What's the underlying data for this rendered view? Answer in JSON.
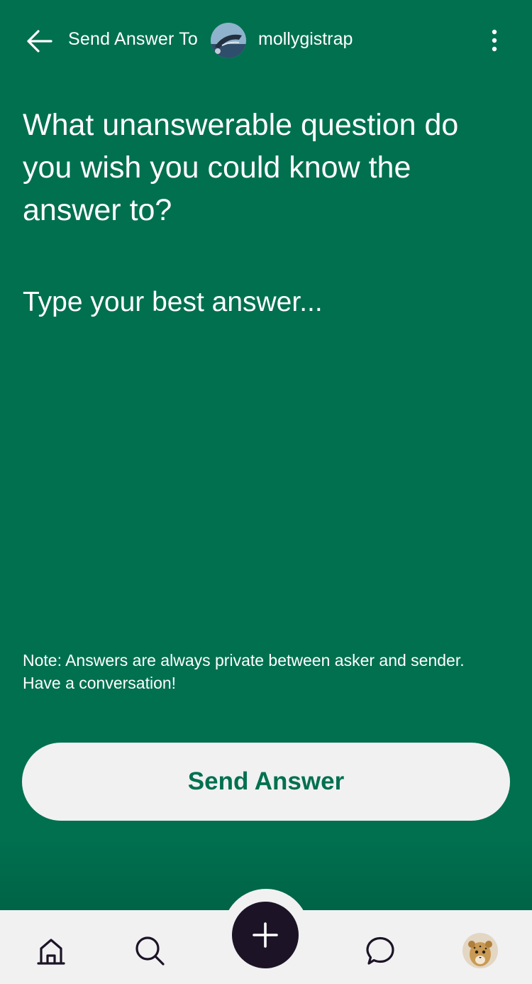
{
  "header": {
    "title": "Send Answer To",
    "recipient": "mollygistrap",
    "back_icon": "arrow-left-icon",
    "more_icon": "vertical-dots-icon"
  },
  "question": "What unanswerable question do you wish you could know the answer to?",
  "answer": {
    "value": "",
    "placeholder": "Type your best answer..."
  },
  "note": "Note: Answers are always private between asker and sender. Have a conversation!",
  "send_button": "Send Answer",
  "tabbar": {
    "items": [
      "home-icon",
      "search-icon",
      "plus-icon",
      "chat-bubble-icon",
      "profile-avatar"
    ]
  },
  "colors": {
    "background": "#00704f",
    "button": "#f1f1f2",
    "fab": "#1c1426"
  }
}
